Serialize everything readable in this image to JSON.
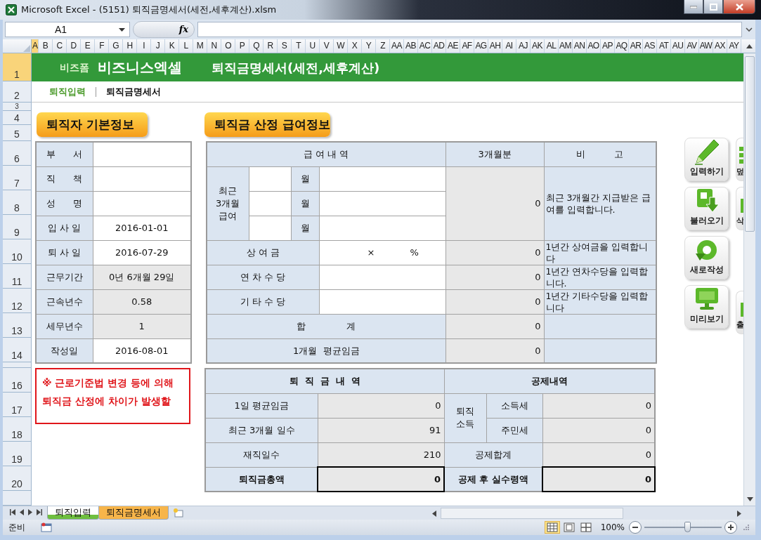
{
  "window": {
    "title": "Microsoft Excel - (5151) 퇴직금명세서(세전,세후계산).xlsm"
  },
  "formula_bar": {
    "name_box": "A1",
    "function_label": "fx"
  },
  "columns": [
    {
      "label": "A",
      "selected": true
    },
    {
      "label": "B",
      "selected": false
    },
    {
      "label": "C",
      "selected": false
    },
    {
      "label": "D",
      "selected": false
    },
    {
      "label": "E",
      "selected": false
    },
    {
      "label": "F",
      "selected": false
    },
    {
      "label": "G",
      "selected": false
    },
    {
      "label": "H",
      "selected": false
    },
    {
      "label": "I",
      "selected": false
    },
    {
      "label": "J",
      "selected": false
    },
    {
      "label": "K",
      "selected": false
    },
    {
      "label": "L",
      "selected": false
    },
    {
      "label": "M",
      "selected": false
    },
    {
      "label": "N",
      "selected": false
    },
    {
      "label": "O",
      "selected": false
    },
    {
      "label": "P",
      "selected": false
    },
    {
      "label": "Q",
      "selected": false
    },
    {
      "label": "R",
      "selected": false
    },
    {
      "label": "S",
      "selected": false
    },
    {
      "label": "T",
      "selected": false
    },
    {
      "label": "U",
      "selected": false
    },
    {
      "label": "V",
      "selected": false
    },
    {
      "label": "W",
      "selected": false
    },
    {
      "label": "X",
      "selected": false
    },
    {
      "label": "Y",
      "selected": false
    },
    {
      "label": "Z",
      "selected": false
    },
    {
      "label": "AA",
      "selected": false
    },
    {
      "label": "AB",
      "selected": false
    },
    {
      "label": "AC",
      "selected": false
    },
    {
      "label": "AD",
      "selected": false
    },
    {
      "label": "AE",
      "selected": false
    },
    {
      "label": "AF",
      "selected": false
    },
    {
      "label": "AG",
      "selected": false
    },
    {
      "label": "AH",
      "selected": false
    },
    {
      "label": "AI",
      "selected": false
    },
    {
      "label": "AJ",
      "selected": false
    },
    {
      "label": "AK",
      "selected": false
    },
    {
      "label": "AL",
      "selected": false
    },
    {
      "label": "AM",
      "selected": false
    },
    {
      "label": "AN",
      "selected": false
    },
    {
      "label": "AO",
      "selected": false
    },
    {
      "label": "AP",
      "selected": false
    },
    {
      "label": "AQ",
      "selected": false
    },
    {
      "label": "AR",
      "selected": false
    },
    {
      "label": "AS",
      "selected": false
    },
    {
      "label": "AT",
      "selected": false
    },
    {
      "label": "AU",
      "selected": false
    },
    {
      "label": "AV",
      "selected": false
    },
    {
      "label": "AW",
      "selected": false
    },
    {
      "label": "AX",
      "selected": false
    },
    {
      "label": "AY",
      "selected": false
    }
  ],
  "rows": [
    {
      "label": "1",
      "selected": true
    },
    {
      "label": "2",
      "selected": false
    },
    {
      "label": "3",
      "selected": false
    },
    {
      "label": "4",
      "selected": false
    },
    {
      "label": "5",
      "selected": false
    },
    {
      "label": "6",
      "selected": false
    },
    {
      "label": "7",
      "selected": false
    },
    {
      "label": "8",
      "selected": false
    },
    {
      "label": "9",
      "selected": false
    },
    {
      "label": "10",
      "selected": false
    },
    {
      "label": "11",
      "selected": false
    },
    {
      "label": "12",
      "selected": false
    },
    {
      "label": "13",
      "selected": false
    },
    {
      "label": "14",
      "selected": false
    },
    {
      "label": "16",
      "selected": false
    },
    {
      "label": "17",
      "selected": false
    },
    {
      "label": "18",
      "selected": false
    },
    {
      "label": "19",
      "selected": false
    },
    {
      "label": "20",
      "selected": false
    }
  ],
  "banner": {
    "brand_small": "비즈폼",
    "brand": "비즈니스엑셀",
    "title": "퇴직금명세서(세전,세후계산)"
  },
  "nav": [
    {
      "label": "퇴직입력",
      "selected": false
    },
    {
      "label": "퇴직금명세서",
      "selected": true
    }
  ],
  "basic_info": {
    "title": "퇴직자 기본정보",
    "rows": [
      {
        "label": "부      서",
        "calculated": false
      },
      {
        "label": "직      책",
        "calculated": false
      },
      {
        "label": "성      명",
        "calculated": false
      },
      {
        "label": "입 사 일",
        "value": "2016-01-01",
        "calculated": false
      },
      {
        "label": "퇴 사 일",
        "value": "2016-07-29",
        "calculated": false
      },
      {
        "label": "근무기간",
        "value": "0년 6개월 29일",
        "calculated": true
      },
      {
        "label": "근속년수",
        "value": "0.58",
        "calculated": true
      },
      {
        "label": "세무년수",
        "value": "1",
        "calculated": true
      },
      {
        "label": "작성일",
        "value": "2016-08-01",
        "calculated": false
      }
    ]
  },
  "salary_info": {
    "title": "퇴직금 산정 급여정보",
    "header": [
      "급 여 내 역",
      "3개월분",
      "비          고"
    ],
    "recent": {
      "label": "최근 3개월 급여",
      "units": [
        "월",
        "월",
        "월"
      ],
      "total": "0",
      "note": "최근 3개월간 지급받은 급여를 입력합니다."
    },
    "items": [
      {
        "label": "상 여 금",
        "multiply": "×",
        "percent": "%",
        "total": "0",
        "note": "1년간 상여금을 입력합니다"
      },
      {
        "label": "연 차 수 당",
        "total": "0",
        "note": "1년간 연차수당을 입력합니다."
      },
      {
        "label": "기 타 수 당",
        "total": "0",
        "note": "1년간 기타수당을 입력합니다"
      }
    ],
    "summary": [
      {
        "label": "합              계",
        "total": "0"
      },
      {
        "label": "1개월  평균임금",
        "total": "0"
      }
    ]
  },
  "notice": "※ 근로기준법 변경 등에 의해\n퇴직금 산정에 차이가 발생할",
  "retirement": {
    "title": "퇴  직  금  내  역",
    "rows": [
      {
        "label": "1일 평균임금",
        "value": "0",
        "emphasis": false
      },
      {
        "label": "최근 3개월 일수",
        "value": "91",
        "emphasis": false
      },
      {
        "label": "재직일수",
        "value": "210",
        "emphasis": false
      },
      {
        "label": "퇴직금총액",
        "value": "0",
        "emphasis": true
      }
    ]
  },
  "deduction": {
    "title": "공제내역",
    "group": {
      "label": "퇴직 소득",
      "rows": [
        {
          "label": "소득세",
          "value": "0"
        },
        {
          "label": "주민세",
          "value": "0"
        }
      ]
    },
    "rows": [
      {
        "label": "공제합계",
        "value": "0",
        "emphasis": false
      },
      {
        "label": "공제 후 실수령액",
        "value": "0",
        "emphasis": true
      }
    ]
  },
  "buttons": [
    {
      "label": "입력하기",
      "kind": "pencil"
    },
    {
      "label": "불러오기",
      "kind": "load"
    },
    {
      "label": "새로작성",
      "kind": "refresh"
    },
    {
      "label": "미리보기",
      "kind": "monitor"
    }
  ],
  "side_buttons": [
    {
      "label": "덮",
      "kind": "bars"
    },
    {
      "label": "삭",
      "kind": "plain"
    },
    {
      "label": "출",
      "kind": "plain"
    }
  ],
  "sheet_tabs": [
    {
      "label": "퇴직입력",
      "selected": true,
      "color": "#6fbf3f"
    },
    {
      "label": "퇴직금명세서",
      "selected": false,
      "color": "#f7b54a"
    }
  ],
  "status": {
    "text": "준비",
    "zoom": "100%"
  },
  "views": [
    {
      "kind": "normal",
      "selected": true
    },
    {
      "kind": "layout",
      "selected": false
    },
    {
      "kind": "pagebreak",
      "selected": false
    }
  ],
  "zoom_slider": {
    "level": 0.55
  }
}
